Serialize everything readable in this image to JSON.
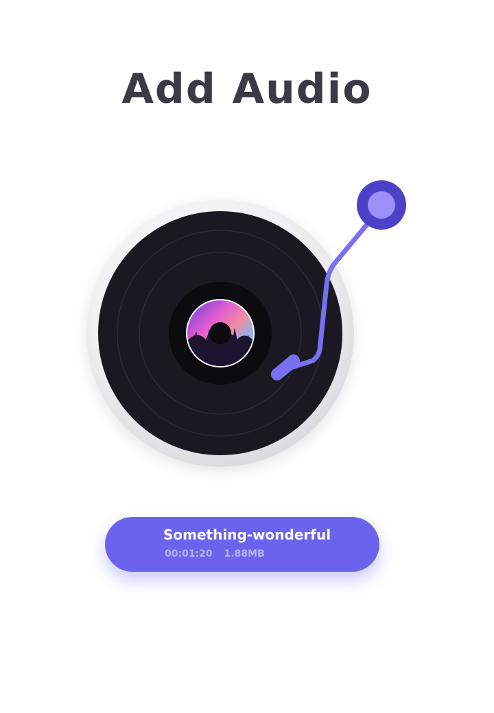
{
  "header": {
    "title": "Add Audio"
  },
  "track": {
    "name": "Something-wonderful",
    "duration": "00:01:20",
    "size": "1.88MB"
  },
  "colors": {
    "accent": "#6b63ee",
    "record": "#1a1821",
    "title": "#3a3b45",
    "tonearm": "#7a6ff2",
    "tonearm_base": "#4d42c7"
  }
}
